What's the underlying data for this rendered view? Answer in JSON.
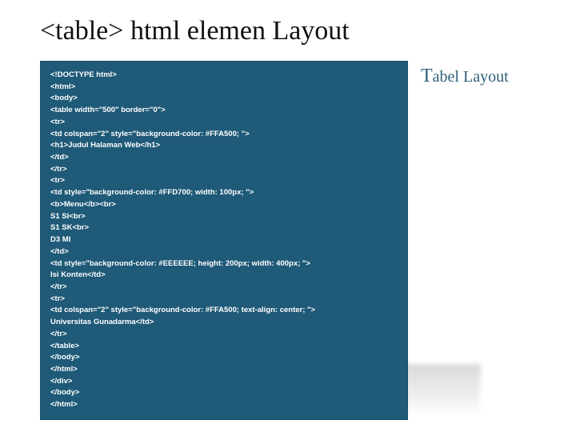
{
  "title": {
    "tag": "<table>",
    "rest": " html elemen Layout"
  },
  "caption": {
    "first": "T",
    "rest": "abel Layout"
  },
  "code_lines": [
    "<!DOCTYPE html>",
    "<html>",
    "<body>",
    "<table width=\"500\" border=\"0\">",
    "<tr>",
    "<td colspan=\"2\" style=\"background-color: #FFA500; \">",
    "<h1>Judul Halaman Web</h1>",
    "</td>",
    "</tr>",
    "<tr>",
    "<td style=\"background-color: #FFD700; width: 100px; \">",
    "<b>Menu</b><br>",
    "S1 SI<br>",
    "S1 SK<br>",
    "D3 MI",
    "</td>",
    "<td style=\"background-color: #EEEEEE; height: 200px; width: 400px; \">",
    "Isi Konten</td>",
    "</tr>",
    "<tr>",
    "<td colspan=\"2\" style=\"background-color: #FFA500; text-align: center; \">",
    "Universitas Gunadarma</td>",
    "</tr>",
    "</table>",
    "</body>",
    "</html>",
    "</div>",
    "</body>",
    "</html>"
  ]
}
